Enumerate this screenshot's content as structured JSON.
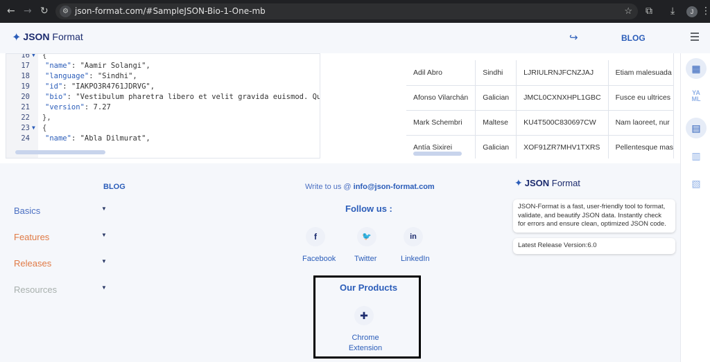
{
  "browser": {
    "url": "json-format.com/#SampleJSON-Bio-1-One-mb",
    "profile_initial": "J"
  },
  "header": {
    "logo_bold": "JSON",
    "logo_rest": " Format",
    "blog_label": "BLOG"
  },
  "editor": {
    "lines": [
      {
        "n": "16",
        "fold": true,
        "text": "{"
      },
      {
        "n": "17",
        "key": "\"name\"",
        "val": ": \"Aamir Solangi\","
      },
      {
        "n": "18",
        "key": "\"language\"",
        "val": ": \"Sindhi\","
      },
      {
        "n": "19",
        "key": "\"id\"",
        "val": ": \"IAKPO3R4761JDRVG\","
      },
      {
        "n": "20",
        "key": "\"bio\"",
        "val": ": \"Vestibulum pharetra libero et velit gravida euismod. Qui"
      },
      {
        "n": "21",
        "key": "\"version\"",
        "val": ": 7.27"
      },
      {
        "n": "22",
        "text": "},"
      },
      {
        "n": "23",
        "fold": true,
        "text": "{"
      },
      {
        "n": "24",
        "key": "\"name\"",
        "val": ": \"Abla Dilmurat\","
      }
    ]
  },
  "table": {
    "rows": [
      [
        "Adil Abro",
        "Sindhi",
        "LJRIULRNJFCNZJAJ",
        "Etiam malesuada"
      ],
      [
        "Afonso Vilarchán",
        "Galician",
        "JMCL0CXNXHPL1GBC",
        "Fusce eu ultrices"
      ],
      [
        "Mark Schembri",
        "Maltese",
        "KU4T500C830697CW",
        "Nam laoreet, nur"
      ],
      [
        "Antía Sixirei",
        "Galician",
        "XOF91ZR7MHV1TXRS",
        "Pellentesque mas"
      ]
    ]
  },
  "sidebar_tools": {
    "yaml_top": "YA",
    "yaml_bottom": "ML"
  },
  "footer": {
    "blog_label": "BLOG",
    "categories": [
      {
        "label": "Basics",
        "color": "#4a6fc2"
      },
      {
        "label": "Features",
        "color": "#e07a45"
      },
      {
        "label": "Releases",
        "color": "#e07a45"
      },
      {
        "label": "Resources",
        "color": "#a8b0ad"
      }
    ],
    "write_prefix": "Write to us @ ",
    "email": "info@json-format.com",
    "follow_title": "Follow us :",
    "social": [
      {
        "label": "Facebook",
        "glyph": "f"
      },
      {
        "label": "Twitter",
        "glyph": "🐦"
      },
      {
        "label": "LinkedIn",
        "glyph": "in"
      }
    ],
    "products_title": "Our Products",
    "product_label": "Chrome Extension",
    "logo_bold": "JSON",
    "logo_rest": " Format",
    "description": "JSON-Format is a fast, user-friendly tool to format, validate, and beautify JSON data. Instantly check for errors and ensure clean, optimized JSON code.",
    "release": "Latest Release Version:6.0"
  },
  "colors": {
    "accent": "#2b5db9",
    "brand_dark": "#1c2b6e",
    "orange": "#e07a45"
  }
}
